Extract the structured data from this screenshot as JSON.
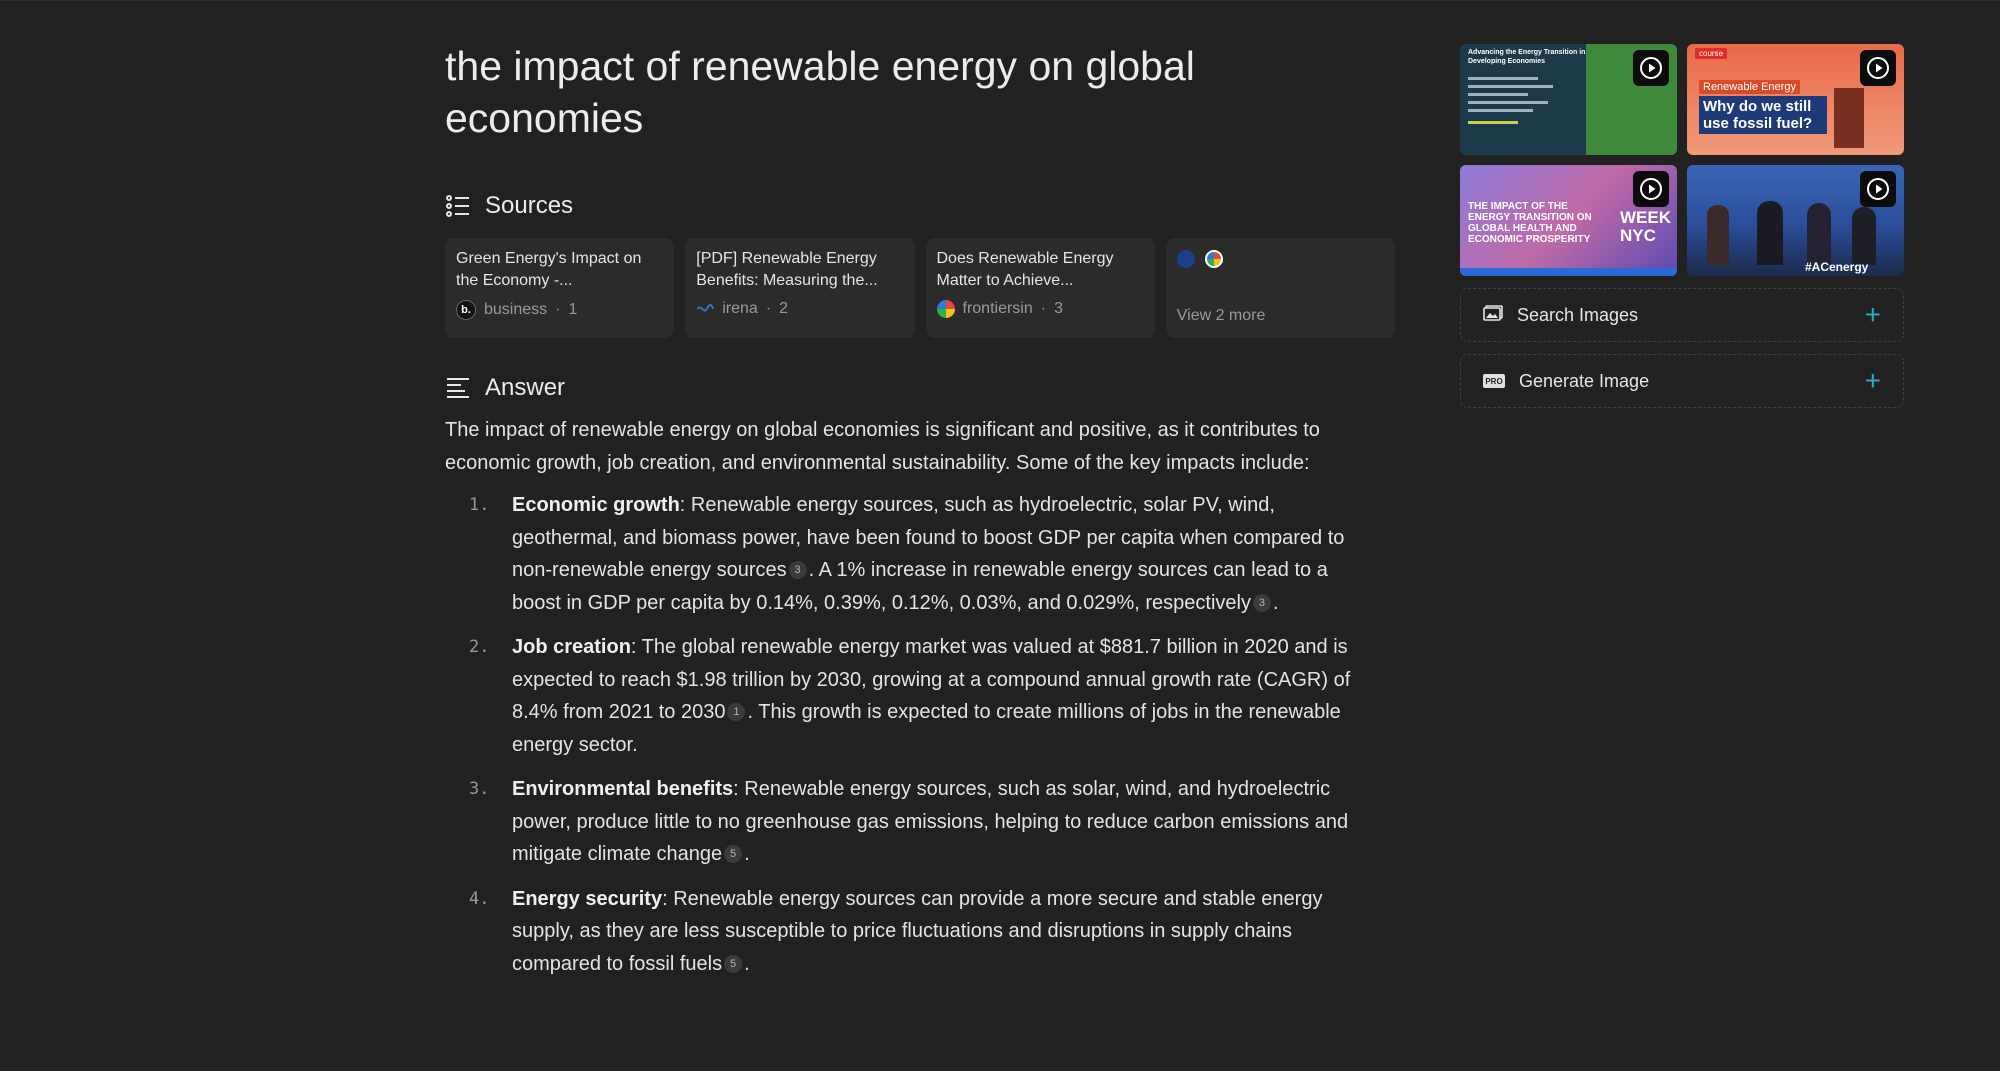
{
  "query": "the impact of renewable energy on global economies",
  "sources_heading": "Sources",
  "sources": [
    {
      "title": "Green Energy's Impact on the Economy -...",
      "site": "business",
      "index": "1",
      "favicon": "b."
    },
    {
      "title": "[PDF] Renewable Energy Benefits: Measuring the...",
      "site": "irena",
      "index": "2"
    },
    {
      "title": "Does Renewable Energy Matter to Achieve...",
      "site": "frontiersin",
      "index": "3"
    }
  ],
  "view_more": "View 2 more",
  "answer_heading": "Answer",
  "answer": {
    "intro": "The impact of renewable energy on global economies is significant and positive, as it contributes to economic growth, job creation, and environmental sustainability. Some of the key impacts include:",
    "items": [
      {
        "num": "1.",
        "title": "Economic growth",
        "p1": ": Renewable energy sources, such as hydroelectric, solar PV, wind, geothermal, and biomass power, have been found to boost GDP per capita when compared to non-renewable energy sources",
        "c1": "3",
        "p2": ". A 1% increase in renewable energy sources can lead to a boost in GDP per capita by 0.14%, 0.39%, 0.12%, 0.03%, and 0.029%, respectively",
        "c2": "3",
        "p3": "."
      },
      {
        "num": "2.",
        "title": "Job creation",
        "p1": ": The global renewable energy market was valued at $881.7 billion in 2020 and is expected to reach $1.98 trillion by 2030, growing at a compound annual growth rate (CAGR) of 8.4% from 2021 to 2030",
        "c1": "1",
        "p2": ". This growth is expected to create millions of jobs in the renewable energy sector."
      },
      {
        "num": "3.",
        "title": "Environmental benefits",
        "p1": ": Renewable energy sources, such as solar, wind, and hydroelectric power, produce little to no greenhouse gas emissions, helping to reduce carbon emissions and mitigate climate change",
        "c1": "5",
        "p2": "."
      },
      {
        "num": "4.",
        "title": "Energy security",
        "p1": ": Renewable energy sources can provide a more secure and stable energy supply, as they are less susceptible to price fluctuations and disruptions in supply chains compared to fossil fuels",
        "c1": "5",
        "p2": "."
      }
    ]
  },
  "videos": [
    {
      "title": "Advancing the Energy Transition in Developing Economies",
      "icon": "play-icon"
    },
    {
      "badge": "course",
      "kicker": "Renewable Energy",
      "title": "Why do we still use fossil fuel?",
      "icon": "play-icon"
    },
    {
      "title": "THE IMPACT OF THE ENERGY TRANSITION ON GLOBAL HEALTH AND ECONOMIC PROSPERITY",
      "tag": "WEEK NYC",
      "icon": "play-icon"
    },
    {
      "tag": "#ACenergy",
      "icon": "play-icon"
    }
  ],
  "side_actions": {
    "search_images": "Search Images",
    "generate_image": "Generate Image",
    "pro_badge": "PRO"
  },
  "colors": {
    "background": "#202120",
    "accent": "#2aa9be",
    "card": "#2a2b2a"
  }
}
